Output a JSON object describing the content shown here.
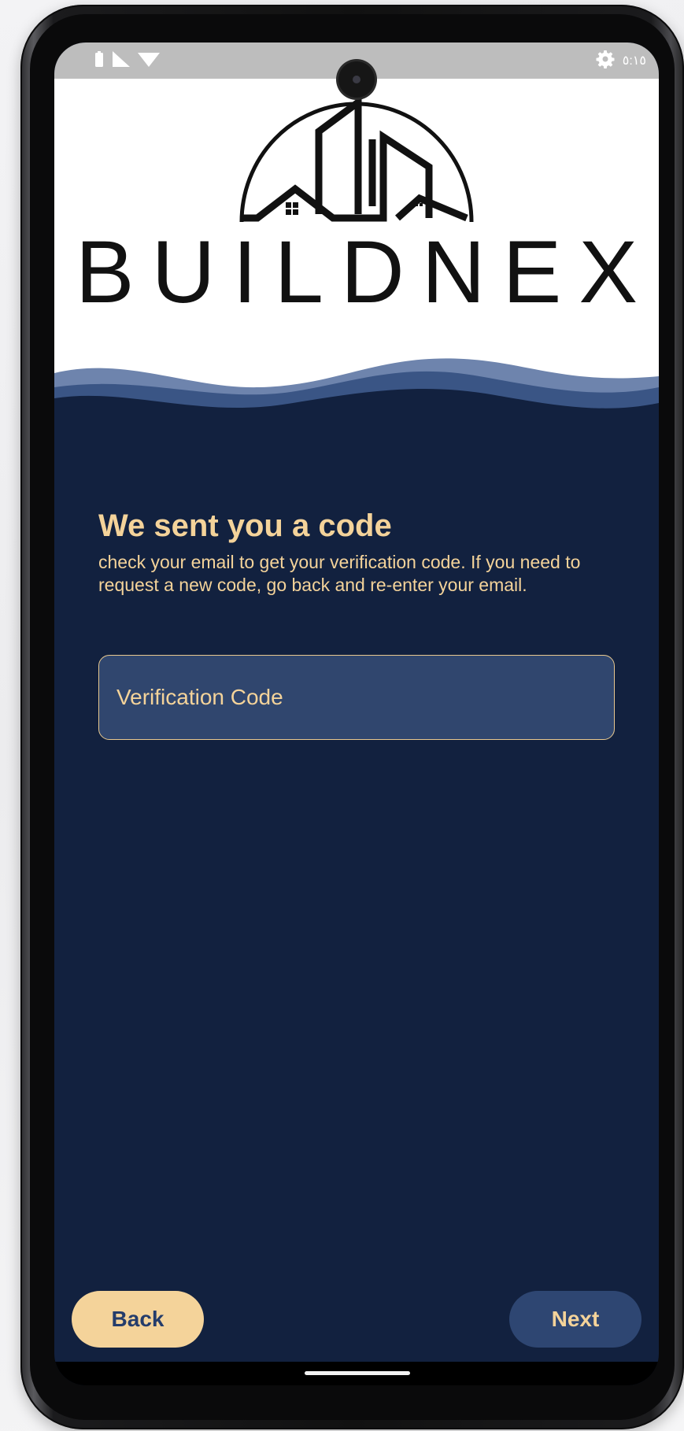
{
  "status_bar": {
    "time": "٥:١٥",
    "icons": [
      "battery-icon",
      "signal-icon",
      "wifi-icon",
      "settings-gear-icon"
    ]
  },
  "header": {
    "brand_name": "BUILDNEX",
    "logo": "buildnex-house-logo"
  },
  "colors": {
    "navy": "#12213f",
    "input_bg": "#30466e",
    "gold": "#f4d39a",
    "wave_light": "#6e84ad",
    "wave_mid": "#3a5585"
  },
  "verification": {
    "title": "We sent you a code",
    "description": "check your email to get your verification code. If you need to request a new code, go back and re-enter your email.",
    "code_placeholder": "Verification Code",
    "code_value": ""
  },
  "actions": {
    "back_label": "Back",
    "next_label": "Next"
  }
}
